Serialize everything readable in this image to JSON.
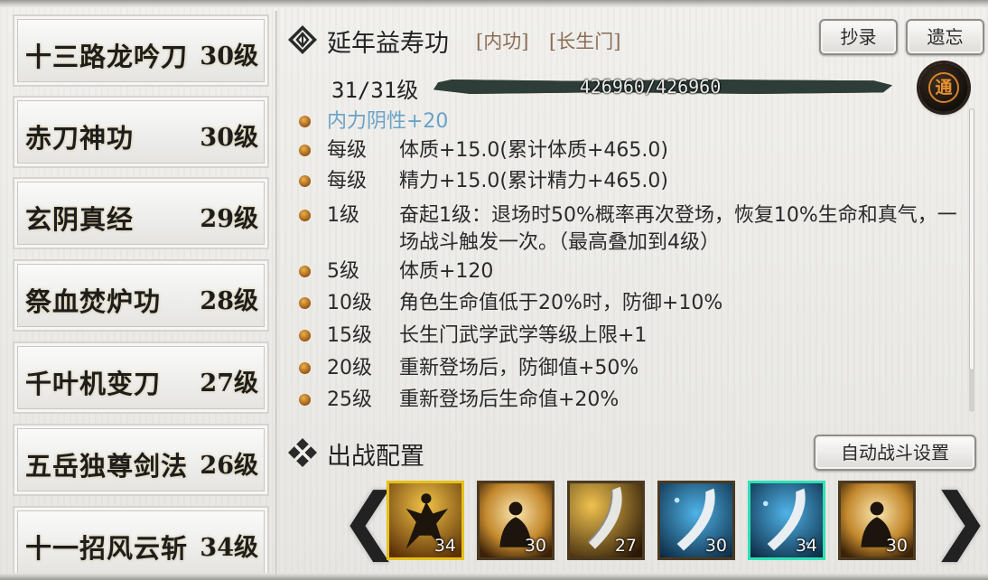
{
  "left_list": [
    {
      "name": "十三路龙吟刀",
      "level": "30级"
    },
    {
      "name": "赤刀神功",
      "level": "30级"
    },
    {
      "name": "玄阴真经",
      "level": "29级"
    },
    {
      "name": "祭血焚炉功",
      "level": "28级"
    },
    {
      "name": "千叶机变刀",
      "level": "27级"
    },
    {
      "name": "五岳独尊剑法",
      "level": "26级"
    },
    {
      "name": "十一招风云斩",
      "level": "34级"
    }
  ],
  "skill": {
    "title": "延年益寿功",
    "tag1": "[内功]",
    "tag2": "[长生门]",
    "copy_button": "抄录",
    "forget_button": "遗忘",
    "level": "31/31级",
    "exp": "426960/426960",
    "exp_progress": 1.0,
    "badge_char": "通"
  },
  "effects": {
    "header": "内力阴性+20",
    "header_color": "#6aa3c8",
    "rows": [
      {
        "key": "每级",
        "value": "体质+15.0(累计体质+465.0)"
      },
      {
        "key": "每级",
        "value": "精力+15.0(累计精力+465.0)"
      },
      {
        "key": "1级",
        "value": "奋起1级：退场时50%概率再次登场，恢复10%生命和真气，一场战斗触发一次。（最高叠加到4级）"
      },
      {
        "key": "5级",
        "value": "体质+120"
      },
      {
        "key": "10级",
        "value": "角色生命值低于20%时，防御+10%"
      },
      {
        "key": "15级",
        "value": "长生门武学武学等级上限+1"
      },
      {
        "key": "20级",
        "value": "重新登场后，防御值+50%"
      },
      {
        "key": "25级",
        "value": "重新登场后生命值+20%"
      }
    ]
  },
  "battle": {
    "title": "出战配置",
    "auto_button": "自动战斗设置",
    "left_arrow": "❮",
    "right_arrow": "❯",
    "slots": [
      {
        "count": "34",
        "art": "fighter-art",
        "state": "selected-gold"
      },
      {
        "count": "30",
        "art": "meditate-art",
        "state": "normal"
      },
      {
        "count": "27",
        "art": "blade-art",
        "state": "normal"
      },
      {
        "count": "30",
        "art": "blue-blade-art",
        "state": "normal"
      },
      {
        "count": "34",
        "art": "blue-blade-art",
        "state": "selected-teal"
      },
      {
        "count": "30",
        "art": "meditate-art",
        "state": "normal"
      }
    ]
  }
}
